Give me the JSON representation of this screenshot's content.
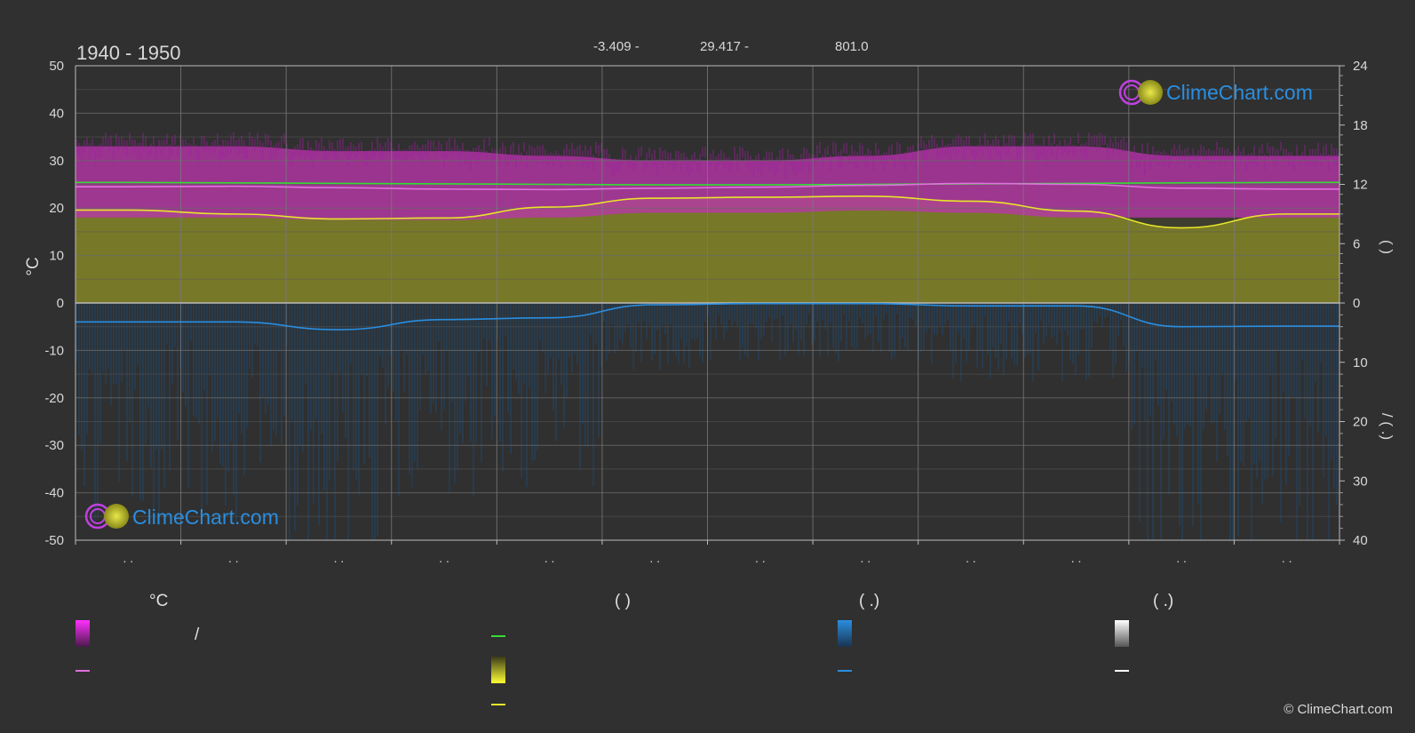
{
  "chart_data": {
    "type": "area",
    "title": "1940 - 1950",
    "coords": {
      "lat": "-3.409 -",
      "lon": "29.417 -",
      "elevation": "801.0"
    },
    "ylabel_left": "°C",
    "ylabel_right_top": "(   )",
    "ylabel_right_bottom": "/   (   .)",
    "y_left": {
      "min": -50,
      "max": 50,
      "ticks": [
        "50",
        "40",
        "30",
        "20",
        "10",
        "0",
        "-10",
        "-20",
        "-30",
        "-40",
        "-50"
      ]
    },
    "y_right_top": {
      "min": 0,
      "max": 24,
      "ticks": [
        "24",
        "18",
        "12",
        "6",
        "0"
      ]
    },
    "y_right_bottom": {
      "min": 0,
      "max": 40,
      "ticks": [
        "10",
        "20",
        "30",
        "40"
      ]
    },
    "months": [
      ". .",
      ". .",
      ". .",
      ". .",
      ". .",
      ". .",
      ". .",
      ". .",
      ". .",
      ". .",
      ". .",
      ". ."
    ],
    "series": [
      {
        "name": "day_length",
        "unit": "hours",
        "color": "#33dd33",
        "values": [
          12.2,
          12.15,
          12.1,
          12.05,
          12.0,
          11.95,
          11.95,
          12.0,
          12.05,
          12.1,
          12.15,
          12.2
        ]
      },
      {
        "name": "mean_temperature",
        "unit": "°C",
        "color": "#e070e0",
        "values": [
          24.5,
          24.6,
          24.3,
          24.0,
          23.9,
          24.2,
          24.4,
          24.8,
          25.2,
          25.0,
          24.2,
          24.0
        ]
      },
      {
        "name": "sunshine_duration",
        "unit": "hours",
        "color": "#e6e62a",
        "values": [
          9.4,
          9.0,
          8.5,
          8.6,
          9.7,
          10.6,
          10.7,
          10.8,
          10.3,
          9.3,
          7.6,
          9.0
        ]
      },
      {
        "name": "precipitation",
        "unit": "mm",
        "color": "#2a8ee0",
        "values": [
          3.2,
          3.2,
          4.5,
          2.8,
          2.5,
          0.3,
          0.1,
          0.1,
          0.5,
          0.5,
          4.0,
          3.9
        ]
      }
    ],
    "temp_band": {
      "max_top": [
        33,
        33,
        32,
        32,
        31,
        30,
        30,
        31,
        33,
        33,
        31,
        31
      ],
      "min_bottom": [
        18,
        18,
        17.5,
        17.5,
        18,
        19,
        19,
        19.5,
        19,
        18,
        18,
        18
      ]
    },
    "grid": true
  },
  "brand": {
    "logo_text": "ClimeChart.com",
    "copyright": "© ClimeChart.com"
  },
  "legend": {
    "col1": {
      "header": "°C",
      "row1": "/",
      "row2": ""
    },
    "col2": {
      "header": "(           )"
    },
    "col3": {
      "header": "(    .)"
    },
    "col4": {
      "header": "(    .)"
    }
  },
  "colors": {
    "background": "#303030",
    "temp_band": "#b020b0",
    "sunshine_fill": "#9a9a2a",
    "precip": "#2a8ee0",
    "day_length": "#33dd33",
    "grid": "#6a6a6a"
  }
}
